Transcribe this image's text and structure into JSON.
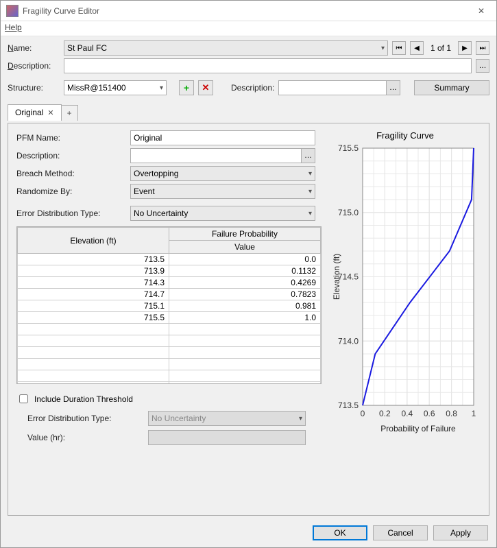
{
  "window": {
    "title": "Fragility Curve Editor"
  },
  "menu": {
    "help": "Help"
  },
  "header": {
    "name_label": "Name:",
    "name_value": "St Paul FC",
    "page_text": "1 of 1",
    "desc_label": "Description:",
    "desc_value": ""
  },
  "structure_row": {
    "structure_label": "Structure:",
    "structure_value": "MissR@151400",
    "desc_label": "Description:",
    "desc_value": "",
    "summary_label": "Summary"
  },
  "tabs": {
    "active": "Original",
    "add": "+"
  },
  "form": {
    "pfm_label": "PFM Name:",
    "pfm_value": "Original",
    "desc_label": "Description:",
    "desc_value": "",
    "breach_label": "Breach Method:",
    "breach_value": "Overtopping",
    "rand_label": "Randomize By:",
    "rand_value": "Event",
    "errdist_label": "Error Distribution Type:",
    "errdist_value": "No Uncertainty"
  },
  "table": {
    "col1": "Elevation (ft)",
    "col2": "Failure Probability",
    "col2sub": "Value",
    "rows": [
      {
        "elev": "713.5",
        "val": "0.0"
      },
      {
        "elev": "713.9",
        "val": "0.1132"
      },
      {
        "elev": "714.3",
        "val": "0.4269"
      },
      {
        "elev": "714.7",
        "val": "0.7823"
      },
      {
        "elev": "715.1",
        "val": "0.981"
      },
      {
        "elev": "715.5",
        "val": "1.0"
      }
    ]
  },
  "duration": {
    "checkbox_label": "Include Duration Threshold",
    "checked": false,
    "errdist_label": "Error Distribution Type:",
    "errdist_value": "No Uncertainty",
    "value_label": "Value (hr):",
    "value_value": ""
  },
  "chart": {
    "title": "Fragility Curve",
    "ylabel": "Elevation (ft)",
    "xlabel": "Probability of Failure",
    "yticks": [
      "713.5",
      "714.0",
      "714.5",
      "715.0",
      "715.5"
    ],
    "xticks": [
      "0",
      "0.2",
      "0.4",
      "0.6",
      "0.8",
      "1"
    ]
  },
  "chart_data": {
    "type": "line",
    "x": [
      0.0,
      0.1132,
      0.4269,
      0.7823,
      0.981,
      1.0
    ],
    "y": [
      713.5,
      713.9,
      714.3,
      714.7,
      715.1,
      715.5
    ],
    "xlabel": "Probability of Failure",
    "ylabel": "Elevation (ft)",
    "xlim": [
      0,
      1
    ],
    "ylim": [
      713.5,
      715.5
    ],
    "title": "Fragility Curve"
  },
  "footer": {
    "ok": "OK",
    "cancel": "Cancel",
    "apply": "Apply"
  }
}
